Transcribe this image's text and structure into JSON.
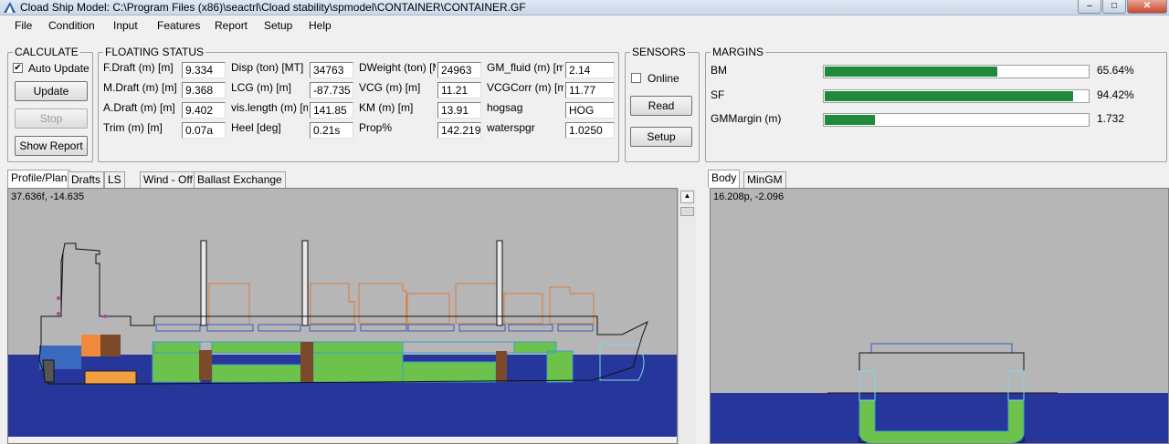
{
  "window": {
    "title": "Cload  Ship Model: C:\\Program Files (x86)\\seactrl\\Cload stability\\spmodel\\CONTAINER\\CONTAINER.GF"
  },
  "menu": [
    "File",
    "Condition",
    "Input",
    "Features",
    "Report",
    "Setup",
    "Help"
  ],
  "calculate": {
    "title": "CALCULATE",
    "auto_update_label": "Auto Update",
    "auto_update_checked": true,
    "update_label": "Update",
    "stop_label": "Stop",
    "show_report_label": "Show Report"
  },
  "floating_status": {
    "title": "FLOATING STATUS",
    "rows": [
      [
        {
          "label": "F.Draft (m) [m]",
          "value": "9.334"
        },
        {
          "label": "Disp (ton) [MT]",
          "value": "34763"
        },
        {
          "label": "DWeight (ton) [MT]",
          "value": "24963"
        },
        {
          "label": "GM_fluid (m) [m]",
          "value": "2.14"
        }
      ],
      [
        {
          "label": "M.Draft (m) [m]",
          "value": "9.368"
        },
        {
          "label": "LCG (m) [m]",
          "value": "-87.735"
        },
        {
          "label": "VCG (m) [m]",
          "value": "11.21"
        },
        {
          "label": "VCGCorr (m) [m]",
          "value": "11.77"
        }
      ],
      [
        {
          "label": "A.Draft (m) [m]",
          "value": "9.402"
        },
        {
          "label": "vis.length (m) [m]",
          "value": "141.85"
        },
        {
          "label": "KM (m) [m]",
          "value": "13.91"
        },
        {
          "label": "hogsag",
          "value": "HOG"
        }
      ],
      [
        {
          "label": "Trim (m) [m]",
          "value": "0.07a"
        },
        {
          "label": "Heel [deg]",
          "value": "0.21s"
        },
        {
          "label": "Prop%",
          "value": "142.219"
        },
        {
          "label": "waterspgr",
          "value": "1.0250"
        }
      ]
    ]
  },
  "sensors": {
    "title": "SENSORS",
    "online_label": "Online",
    "online_checked": false,
    "read_label": "Read",
    "setup_label": "Setup"
  },
  "margins": {
    "title": "MARGINS",
    "items": [
      {
        "label": "BM",
        "value": "65.64%",
        "fraction": 0.6564
      },
      {
        "label": "SF",
        "value": "94.42%",
        "fraction": 0.9442
      },
      {
        "label": "GMMargin (m)",
        "value": "1.732",
        "fraction": 0.19
      }
    ],
    "bar_color": "#1f8a3c"
  },
  "left_tabs": [
    "Profile/Plan",
    "Drafts",
    "LS",
    "Wind - Off",
    "Ballast Exchange"
  ],
  "left_view": {
    "coord": "37.636f, -14.635"
  },
  "right_tabs": [
    "Body",
    "MinGM"
  ],
  "right_view": {
    "coord": "16.208p, -2.096"
  },
  "colors": {
    "sea": "#27369a",
    "sky": "#b6b6b6",
    "ballast": "#6cc24a",
    "cargo_outline": "#d97c3b",
    "bulkhead": "#7a4a2a",
    "hull_outline": "#1a1a1a"
  }
}
